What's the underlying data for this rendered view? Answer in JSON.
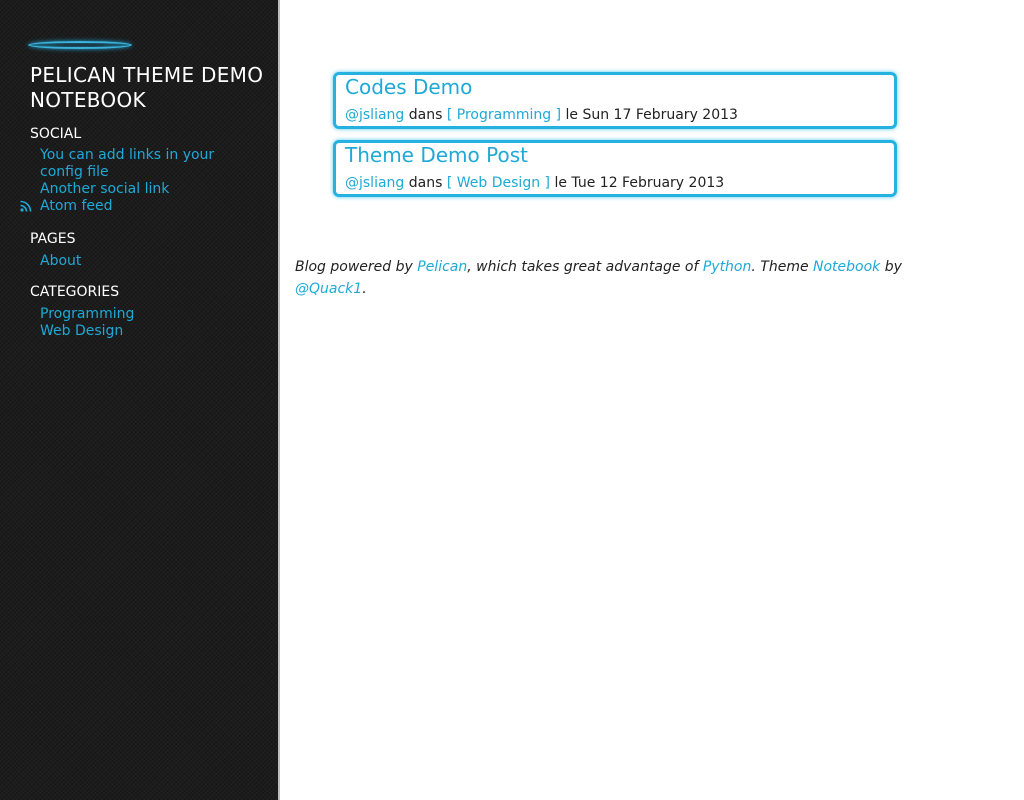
{
  "site": {
    "title": "PELICAN THEME DEMO NOTEBOOK"
  },
  "sidebar": {
    "social": {
      "heading": "SOCIAL",
      "links": [
        {
          "label": "You can add links in your config file"
        },
        {
          "label": "Another social link"
        },
        {
          "label": "Atom feed",
          "icon": "rss-icon"
        }
      ]
    },
    "pages": {
      "heading": "PAGES",
      "links": [
        {
          "label": "About"
        }
      ]
    },
    "categories": {
      "heading": "CATEGORIES",
      "links": [
        {
          "label": "Programming"
        },
        {
          "label": "Web Design"
        }
      ]
    }
  },
  "posts": [
    {
      "title": "Codes Demo",
      "author": "@jsliang",
      "dans": "dans",
      "category": "[ Programming ]",
      "date_prefix": "le",
      "date": "Sun 17 February 2013"
    },
    {
      "title": "Theme Demo Post",
      "author": "@jsliang",
      "dans": "dans",
      "category": "[ Web Design ]",
      "date_prefix": "le",
      "date": "Tue 12 February 2013"
    }
  ],
  "footer": {
    "text1": "Blog powered by ",
    "link_pelican": "Pelican",
    "text2": ", which takes great advantage of ",
    "link_python": "Python",
    "text3": ". Theme ",
    "link_notebook": "Notebook",
    "text4": " by ",
    "link_author": "@Quack1",
    "text5": "."
  },
  "colors": {
    "accent": "#1fa9d6",
    "sidebar_bg": "#1c1c1c",
    "card_border": "#26b2e0"
  }
}
